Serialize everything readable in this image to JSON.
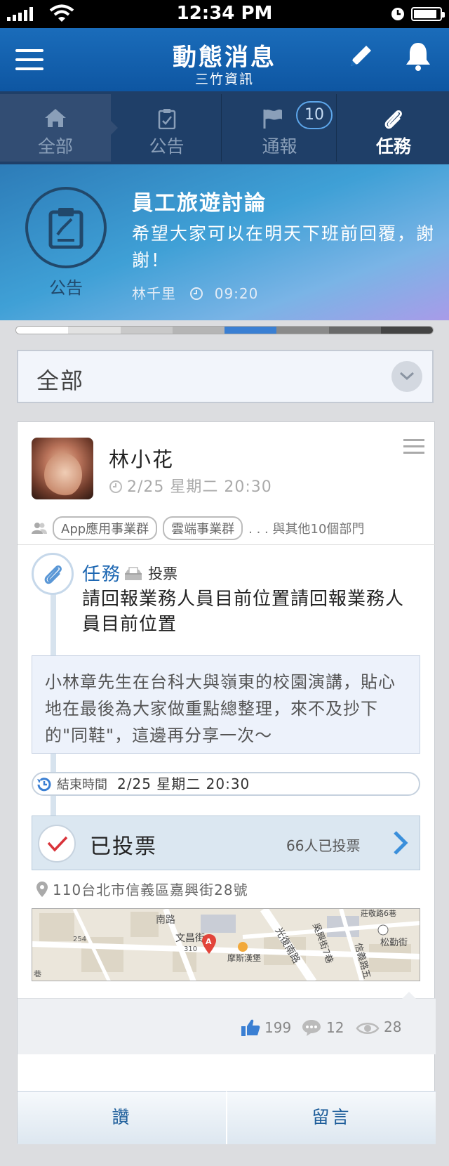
{
  "status_bar": {
    "time": "12:34 PM"
  },
  "header": {
    "title": "動態消息",
    "subtitle": "三竹資訊"
  },
  "tabs": [
    {
      "label": "全部",
      "icon": "home-icon"
    },
    {
      "label": "公告",
      "icon": "clipboard-icon"
    },
    {
      "label": "通報",
      "icon": "flag-icon",
      "badge": "10"
    },
    {
      "label": "任務",
      "icon": "paperclip-icon"
    }
  ],
  "banner": {
    "category": "公告",
    "title": "員工旅遊討論",
    "body": "希望大家可以在明天下班前回覆，謝謝！",
    "author": "林千里",
    "time": "09:20"
  },
  "filter": {
    "label": "全部"
  },
  "post": {
    "author": "林小花",
    "date": "2/25 星期二 20:30",
    "departments": [
      "App應用事業群",
      "雲端事業群"
    ],
    "departments_more": ". . . 與其他10個部門",
    "type": "任務",
    "vote_label": "投票",
    "title": "請回報業務人員目前位置請回報業務人員目前位置",
    "quote": "小林章先生在台科大與嶺東的校園演講，貼心地在最後為大家做重點總整理，來不及抄下的\"同鞋\"，這邊再分享一次～",
    "end_label": "結束時間",
    "end_value": "2/25 星期二 20:30",
    "voted_label": "已投票",
    "voted_count": "66人已投票",
    "location": "110台北市信義區嘉興街28號",
    "map_labels": {
      "road1": "南路",
      "road2": "文昌街",
      "road3": "光復南路",
      "road4": "吳興街7巷",
      "road5": "信義路五",
      "road6": "松勤街",
      "road7": "莊敬路6巷",
      "poi": "摩斯漢堡",
      "num1": "254",
      "num2": "310",
      "pin": "A",
      "road8": "巷"
    },
    "likes": "199",
    "comments": "12",
    "views": "28",
    "like_button": "讚",
    "comment_button": "留言"
  },
  "colors": {
    "header": "#1a6cba",
    "tabs": "#1f3f68",
    "accent": "#1d67b2",
    "vote_check": "#d9333a"
  }
}
